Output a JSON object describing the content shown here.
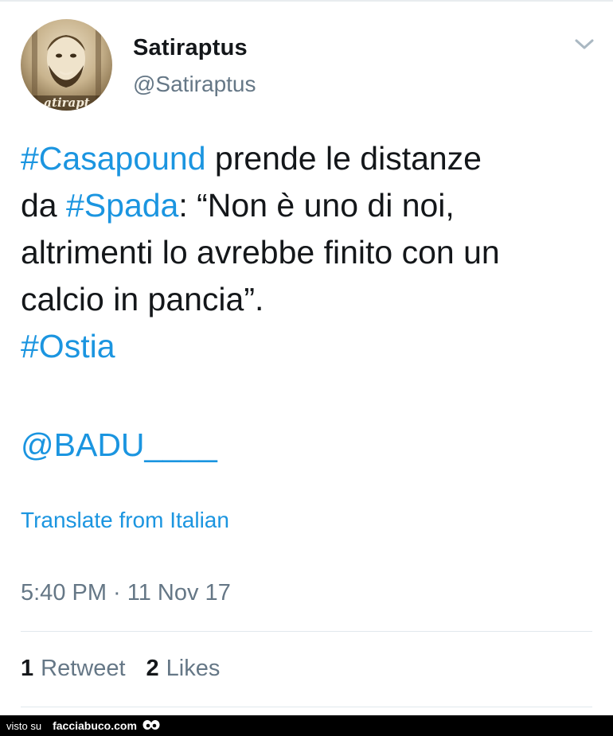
{
  "tweet": {
    "display_name": "Satiraptus",
    "handle": "@Satiraptus",
    "avatar_watermark": "atirapt",
    "text_lines": [
      [
        {
          "t": "#Casapound",
          "link": true
        },
        {
          "t": " prende le distanze",
          "link": false
        }
      ],
      [
        {
          "t": "da ",
          "link": false
        },
        {
          "t": "#Spada",
          "link": true
        },
        {
          "t": ": “Non è uno di noi,",
          "link": false
        }
      ],
      [
        {
          "t": "altrimenti lo avrebbe finito con un",
          "link": false
        }
      ],
      [
        {
          "t": "calcio in pancia”.",
          "link": false
        }
      ],
      [
        {
          "t": "#Ostia",
          "link": true
        }
      ]
    ],
    "mention": "@BADU____",
    "translate_label": "Translate from Italian",
    "timestamp": "5:40 PM · 11 Nov 17",
    "retweets_count": "1",
    "retweets_label": "Retweet",
    "likes_count": "2",
    "likes_label": "Likes"
  },
  "footer": {
    "visto_label": "visto su",
    "brand": "facciabuco.com"
  },
  "colors": {
    "link": "#1b95e0",
    "text": "#14171a",
    "secondary": "#657786",
    "divider": "#e1e8ed",
    "footer_bg": "#000000"
  },
  "icons": {
    "caret": "chevron-down-icon",
    "footer_logo": "eyes-icon"
  }
}
